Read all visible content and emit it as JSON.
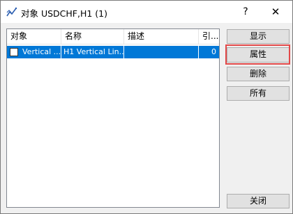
{
  "window": {
    "title": "对象 USDCHF,H1 (1)",
    "help_label": "?",
    "close_label": "✕"
  },
  "list": {
    "columns": [
      "对象",
      "名称",
      "描述",
      "引..."
    ],
    "rows": [
      {
        "checked": false,
        "object": "Vertical ...",
        "name": "H1 Vertical Lin...",
        "description": "",
        "ref": "0",
        "selected": true
      }
    ]
  },
  "buttons": {
    "show": "显示",
    "properties": "属性",
    "delete": "删除",
    "all": "所有",
    "close": "关闭"
  },
  "colors": {
    "selection": "#0078d7",
    "highlight": "#e24848",
    "window_bg": "#f0f0f0"
  },
  "icons": {
    "app": "chart-line-icon"
  }
}
